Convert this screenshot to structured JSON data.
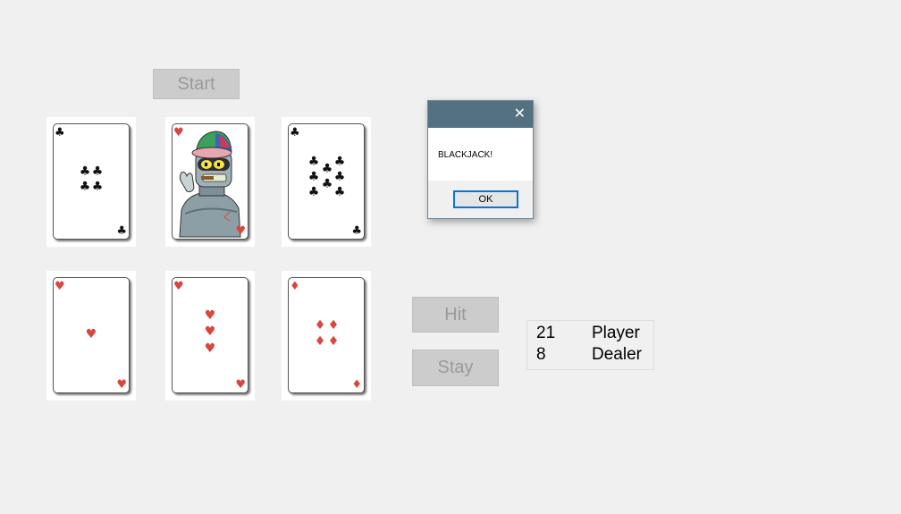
{
  "buttons": {
    "start": "Start",
    "hit": "Hit",
    "stay": "Stay"
  },
  "dealer_cards": [
    {
      "rank": "4",
      "suit": "♣",
      "color": "black"
    },
    {
      "rank": "K",
      "suit": "♥",
      "color": "red",
      "face_image": "robot-king-icon"
    },
    {
      "rank": "7",
      "suit": "♣",
      "color": "black"
    }
  ],
  "player_cards": [
    {
      "rank": "A",
      "suit": "♥",
      "color": "red"
    },
    {
      "rank": "3",
      "suit": "♥",
      "color": "red"
    },
    {
      "rank": "4",
      "suit": "♦",
      "color": "red"
    }
  ],
  "dialog": {
    "close": "✕",
    "message": "BLACKJACK!",
    "ok": "OK"
  },
  "scores": [
    {
      "value": "21",
      "label": "Player"
    },
    {
      "value": "8",
      "label": "Dealer"
    }
  ],
  "colors": {
    "title_bar": "#537181",
    "red_suit": "#d8473f",
    "button_bg": "#cccccc"
  }
}
